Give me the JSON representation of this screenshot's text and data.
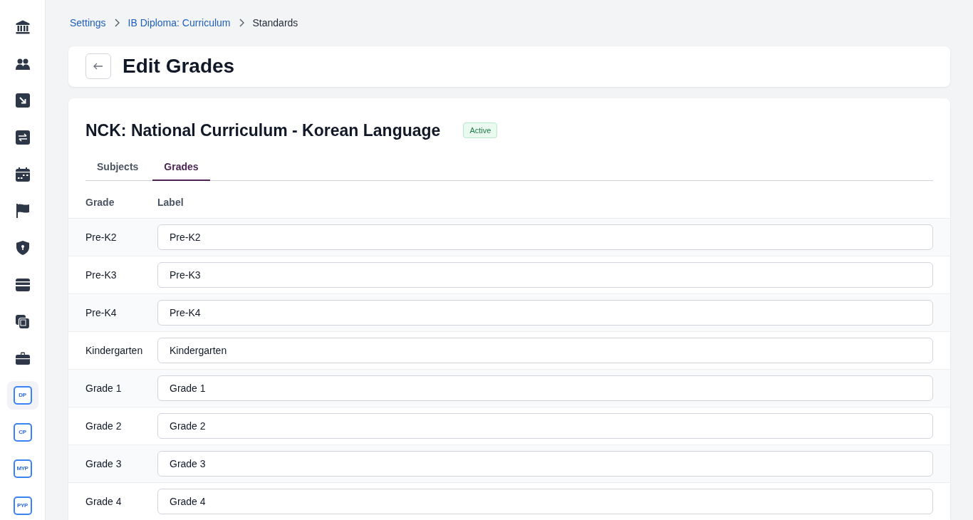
{
  "sidebar": {
    "items": [
      {
        "kind": "icon",
        "selected": false
      },
      {
        "kind": "icon",
        "selected": false
      },
      {
        "kind": "icon",
        "selected": false
      },
      {
        "kind": "icon",
        "selected": false
      },
      {
        "kind": "icon",
        "selected": false
      },
      {
        "kind": "icon",
        "selected": false
      },
      {
        "kind": "icon",
        "selected": false
      },
      {
        "kind": "icon",
        "selected": false
      },
      {
        "kind": "icon",
        "selected": false
      },
      {
        "kind": "icon",
        "selected": false
      },
      {
        "kind": "programme",
        "abbr": "DP",
        "selected": true
      },
      {
        "kind": "programme",
        "abbr": "CP",
        "selected": false
      },
      {
        "kind": "programme",
        "abbr": "MYP",
        "selected": false
      },
      {
        "kind": "programme",
        "abbr": "PYP",
        "selected": false
      }
    ]
  },
  "breadcrumb": [
    {
      "label": "Settings",
      "kind": "link"
    },
    {
      "label": "IB Diploma: Curriculum",
      "kind": "link"
    },
    {
      "label": "Standards",
      "kind": "current"
    }
  ],
  "header": {
    "title": "Edit Grades"
  },
  "curriculum": {
    "title": "NCK: National Curriculum - Korean Language",
    "status": "Active",
    "tabs": [
      {
        "label": "Subjects",
        "selected": false
      },
      {
        "label": "Grades",
        "selected": true
      }
    ],
    "table": {
      "columns": [
        "Grade",
        "Label"
      ],
      "rows": [
        {
          "grade": "Pre-K2",
          "label": "Pre-K2"
        },
        {
          "grade": "Pre-K3",
          "label": "Pre-K3"
        },
        {
          "grade": "Pre-K4",
          "label": "Pre-K4"
        },
        {
          "grade": "Kindergarten",
          "label": "Kindergarten"
        },
        {
          "grade": "Grade 1",
          "label": "Grade 1"
        },
        {
          "grade": "Grade 2",
          "label": "Grade 2"
        },
        {
          "grade": "Grade 3",
          "label": "Grade 3"
        },
        {
          "grade": "Grade 4",
          "label": "Grade 4"
        }
      ]
    }
  }
}
